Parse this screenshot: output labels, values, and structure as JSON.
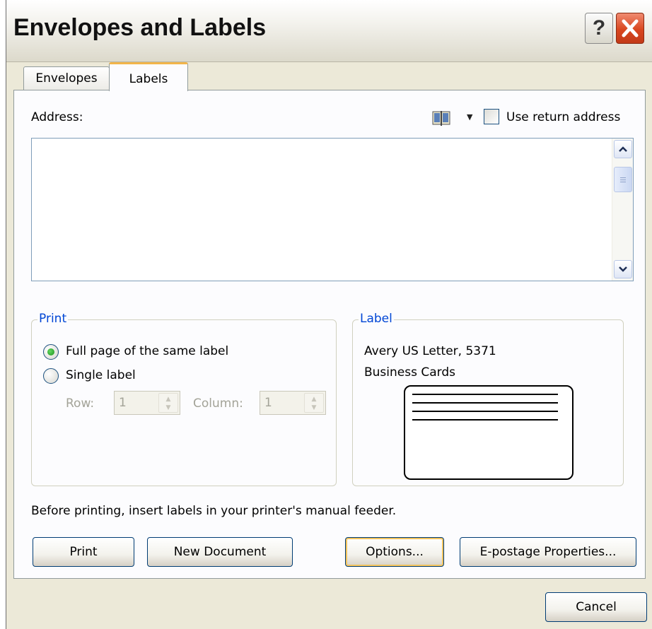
{
  "window": {
    "title": "Envelopes and Labels",
    "help_glyph": "?"
  },
  "tabs": [
    {
      "label": "Envelopes",
      "selected": false
    },
    {
      "label": "Labels",
      "selected": true
    }
  ],
  "address": {
    "label": "Address:",
    "value": "",
    "address_book_icon": "address-book-icon",
    "use_return_address": {
      "label": "Use return address",
      "checked": false
    }
  },
  "print_group": {
    "legend": "Print",
    "full_page": {
      "label": "Full page of the same label",
      "selected": true
    },
    "single_label": {
      "label": "Single label",
      "selected": false
    },
    "row": {
      "label": "Row:",
      "value": "1"
    },
    "column": {
      "label": "Column:",
      "value": "1"
    }
  },
  "label_group": {
    "legend": "Label",
    "line1": "Avery US Letter, 5371",
    "line2": "Business Cards"
  },
  "info_text": "Before printing, insert labels in your printer's manual feeder.",
  "buttons": {
    "print": "Print",
    "new_document": "New Document",
    "options": "Options...",
    "epostage": "E-postage Properties...",
    "cancel": "Cancel"
  },
  "colors": {
    "dialog_bg": "#ece9d8",
    "group_legend": "#0046d5",
    "tab_highlight": "#f2b54a",
    "close_red": "#d9461f"
  }
}
